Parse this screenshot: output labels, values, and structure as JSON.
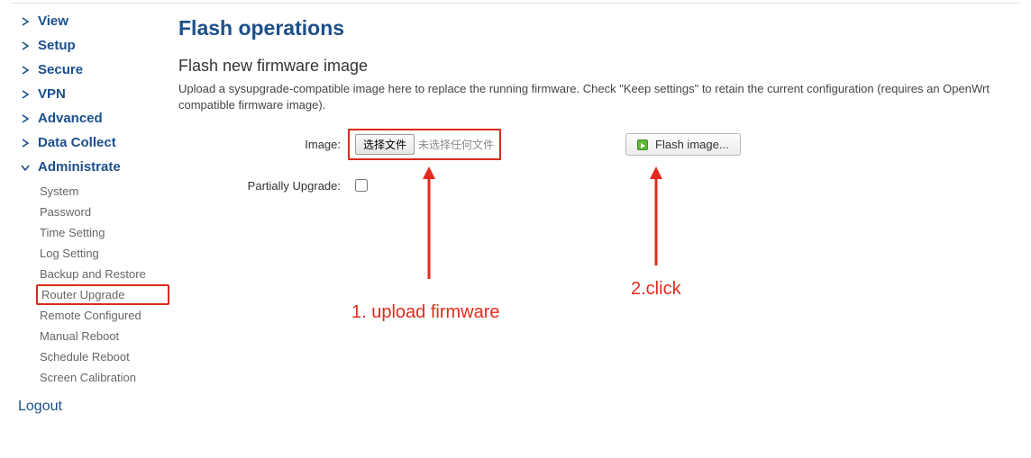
{
  "sidebar": {
    "groups": [
      {
        "label": "View",
        "expanded": false
      },
      {
        "label": "Setup",
        "expanded": false
      },
      {
        "label": "Secure",
        "expanded": false
      },
      {
        "label": "VPN",
        "expanded": false
      },
      {
        "label": "Advanced",
        "expanded": false
      },
      {
        "label": "Data Collect",
        "expanded": false
      },
      {
        "label": "Administrate",
        "expanded": true
      }
    ],
    "admin_items": [
      {
        "label": "System"
      },
      {
        "label": "Password"
      },
      {
        "label": "Time Setting"
      },
      {
        "label": "Log Setting"
      },
      {
        "label": "Backup and Restore"
      },
      {
        "label": "Router Upgrade",
        "active": true
      },
      {
        "label": "Remote Configured"
      },
      {
        "label": "Manual Reboot"
      },
      {
        "label": "Schedule Reboot"
      },
      {
        "label": "Screen Calibration"
      }
    ],
    "logout": "Logout"
  },
  "main": {
    "title": "Flash operations",
    "section_title": "Flash new firmware image",
    "section_desc": "Upload a sysupgrade-compatible image here to replace the running firmware. Check \"Keep settings\" to retain the current configuration (requires an OpenWrt compatible firmware image).",
    "image_label": "Image:",
    "file_button": "选择文件",
    "file_status": "未选择任何文件",
    "flash_button": "Flash image...",
    "partial_label": "Partially Upgrade:"
  },
  "annotations": {
    "step1": "1.  upload firmware",
    "step2": "2.click"
  },
  "colors": {
    "brand_blue": "#1b4f8a",
    "highlight_red": "#d92b1e"
  }
}
